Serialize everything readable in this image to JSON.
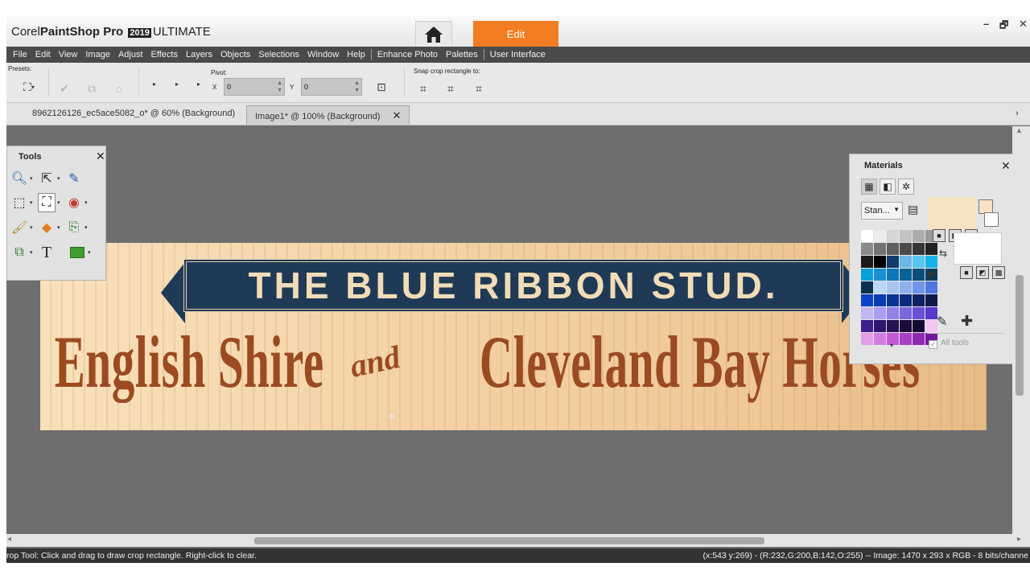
{
  "titlebar": {
    "brand_corel": "Corel",
    "brand_product": "PaintShop Pro",
    "brand_year": "2019",
    "brand_edition": "ULTIMATE",
    "edit_tab": "Edit",
    "minimize": "–",
    "restore": "🗗",
    "close": "✕"
  },
  "menu": {
    "items": [
      "File",
      "Edit",
      "View",
      "Image",
      "Adjust",
      "Effects",
      "Layers",
      "Objects",
      "Selections",
      "Window",
      "Help",
      "Enhance Photo",
      "Palettes",
      "User Interface"
    ]
  },
  "tool_options": {
    "presets_label": "Presets:",
    "pivot_label": "Pivot:",
    "x_label": "X",
    "x_value": "0",
    "y_label": "Y",
    "y_value": "0",
    "snap_label": "Snap crop rectangle to:"
  },
  "doc_tabs": [
    {
      "label": "8962126126_ec5ace5082_o* @  60% (Background)"
    },
    {
      "label": "Image1* @ 100% (Background)"
    }
  ],
  "canvas": {
    "banner_text": "THE BLUE RIBBON STUD.",
    "title_left": "English Shire",
    "title_and": "and",
    "title_right": "Cleveland Bay Horses"
  },
  "tools_palette": {
    "title": "Tools"
  },
  "materials": {
    "title": "Materials",
    "swatch_mode": "Stan...",
    "all_tools": "All tools",
    "foreground_color": "#F8E2C4",
    "background_color": "#FFFFFF",
    "swatches": [
      "#ffffff",
      "#ececec",
      "#d6d6d6",
      "#c2c2c2",
      "#adadad",
      "#999999",
      "#8a8a8a",
      "#737373",
      "#5e5e5e",
      "#4a4a4a",
      "#363636",
      "#222222",
      "#1a1a1a",
      "#000000",
      "#0f3d6e",
      "#6fb7e8",
      "#58c8f0",
      "#19b2e8",
      "#0aa0dc",
      "#1c8fcf",
      "#0e77b8",
      "#0a5f96",
      "#0a4d7a",
      "#073b5e",
      "#0b2f4f",
      "#bcd6f5",
      "#a7c4f2",
      "#8fb1ee",
      "#6f95e6",
      "#4f78de",
      "#0a43c8",
      "#0b3bb0",
      "#0a3396",
      "#0c2a7c",
      "#0d2262",
      "#0f1b4b",
      "#c3b6f3",
      "#ab9df0",
      "#9381ea",
      "#7b66e2",
      "#6a4fd8",
      "#5a38cc",
      "#3e1f8f",
      "#2f1470",
      "#241052",
      "#1b0b3c",
      "#140830",
      "#f4c6f2",
      "#e29ee6",
      "#d27ce0",
      "#c25ad8",
      "#a840c4",
      "#8e2ab0",
      "#74189c"
    ]
  },
  "status": {
    "left": "rop Tool: Click and drag to draw crop rectangle. Right-click to clear.",
    "right": "(x:543 y:269) - (R:232,G:200,B:142,O:255) -- Image:  1470 x 293 x RGB - 8 bits/channe"
  }
}
